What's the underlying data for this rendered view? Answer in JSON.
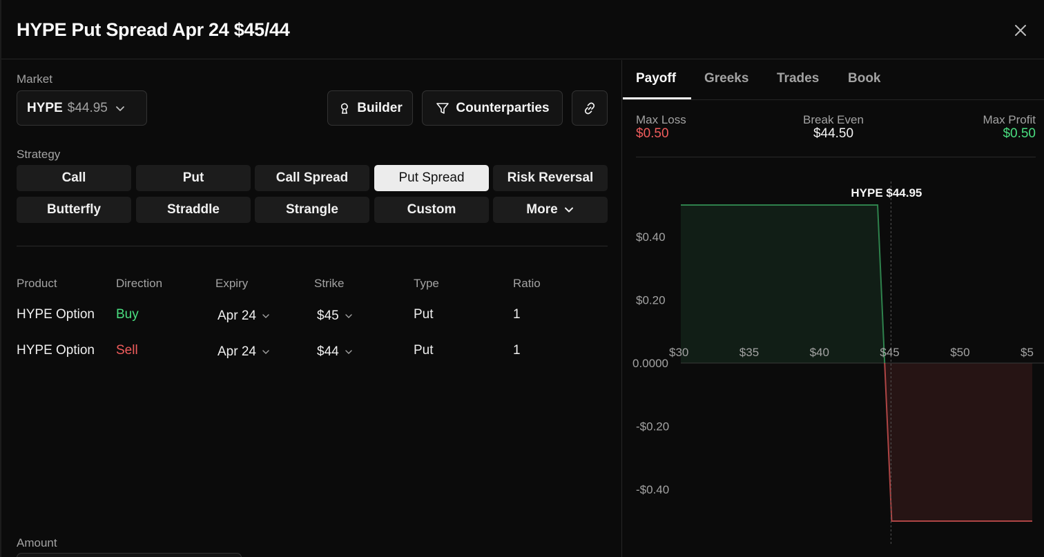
{
  "title": "HYPE Put Spread Apr 24 $45/44",
  "market": {
    "label": "Market",
    "symbol": "HYPE",
    "price": "$44.95"
  },
  "tools": {
    "builder": "Builder",
    "counterparties": "Counterparties"
  },
  "strategy": {
    "label": "Strategy",
    "options": [
      "Call",
      "Put",
      "Call Spread",
      "Put Spread",
      "Risk Reversal",
      "Butterfly",
      "Straddle",
      "Strangle",
      "Custom",
      "More"
    ],
    "selected": "Put Spread"
  },
  "legs": {
    "headers": [
      "Product",
      "Direction",
      "Expiry",
      "Strike",
      "Type",
      "Ratio"
    ],
    "rows": [
      {
        "product": "HYPE Option",
        "direction": "Buy",
        "expiry": "Apr 24",
        "strike": "$45",
        "type": "Put",
        "ratio": "1"
      },
      {
        "product": "HYPE Option",
        "direction": "Sell",
        "expiry": "Apr 24",
        "strike": "$44",
        "type": "Put",
        "ratio": "1"
      }
    ]
  },
  "amount": {
    "label": "Amount"
  },
  "tabs": [
    "Payoff",
    "Greeks",
    "Trades",
    "Book"
  ],
  "active_tab": "Payoff",
  "stats": {
    "max_loss": {
      "label": "Max Loss",
      "value": "$0.50"
    },
    "break_even": {
      "label": "Break Even",
      "value": "$44.50"
    },
    "max_profit": {
      "label": "Max Profit",
      "value": "$0.50"
    }
  },
  "colors": {
    "profit": "#4ade80",
    "loss": "#f05c5c",
    "background": "#0b0b0b"
  },
  "chart_data": {
    "type": "area",
    "x_tick_labels": [
      "$30",
      "$35",
      "$40",
      "$45",
      "$50",
      "$5"
    ],
    "x_ticks": [
      30,
      35,
      40,
      45,
      50,
      55
    ],
    "y_tick_labels": [
      "$0.40",
      "$0.20",
      "0.0000",
      "-$0.20",
      "-$0.40"
    ],
    "y_ticks": [
      0.4,
      0.2,
      0,
      -0.2,
      -0.4
    ],
    "xlim": [
      30,
      55
    ],
    "ylim": [
      -0.5,
      0.5
    ],
    "series": [
      {
        "x": [
          30,
          44,
          45,
          55
        ],
        "y": [
          0.5,
          0.5,
          -0.5,
          -0.5
        ]
      }
    ],
    "spot_label": "HYPE $44.95",
    "spot": 44.95,
    "grid": false
  }
}
